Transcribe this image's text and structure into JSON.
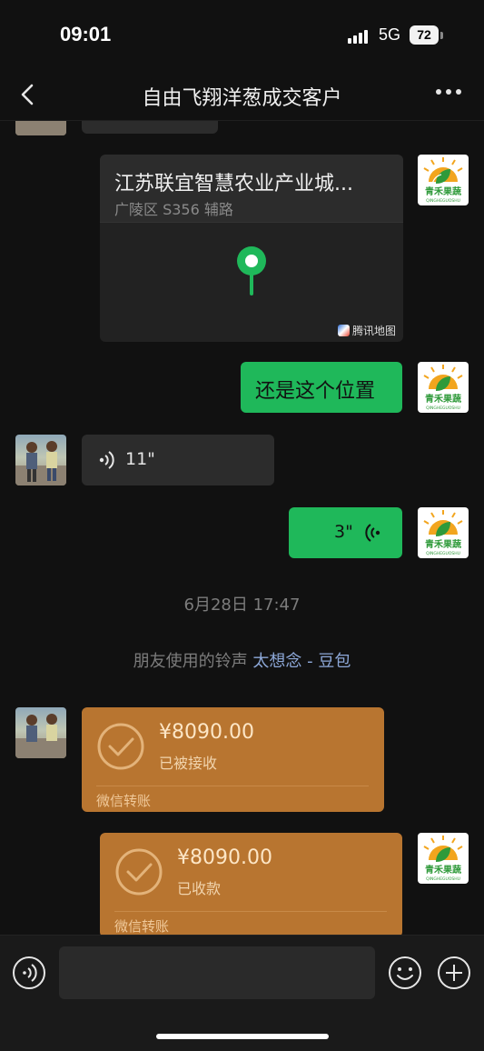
{
  "status_bar": {
    "time": "09:01",
    "network": "5G",
    "battery": "72"
  },
  "header": {
    "title": "自由飞翔洋葱成交客户",
    "back_icon": "chevron-left-icon",
    "more_icon": "more-icon"
  },
  "brand": {
    "name": "青禾果蔬",
    "sub": "QINGHEGUOSHU",
    "green": "#2f9a3a",
    "orange": "#f2a51e"
  },
  "messages": {
    "location": {
      "title": "江苏联宜智慧农业产业城...",
      "address": "广陵区 S356 辅路",
      "map_provider": "腾讯地图"
    },
    "text_1": "还是这个位置",
    "voice_1": "11\"",
    "voice_2": "3\""
  },
  "system": {
    "timestamp": "6月28日 17:47",
    "ringtone_prefix": "朋友使用的铃声",
    "ringtone_song": "太想念 - 豆包"
  },
  "transfers": [
    {
      "amount": "¥8090.00",
      "status": "已被接收",
      "label": "微信转账"
    },
    {
      "amount": "¥8090.00",
      "status": "已收款",
      "label": "微信转账"
    }
  ],
  "colors": {
    "background": "#111111",
    "bubble_green": "#1fb85a",
    "bubble_dark": "#2c2c2c",
    "transfer_orange": "#b87530",
    "link_blue": "#8da8d8"
  },
  "bottom_bar": {
    "voice_icon": "voice-input-icon",
    "emoji_icon": "emoji-icon",
    "add_icon": "plus-circle-icon"
  }
}
